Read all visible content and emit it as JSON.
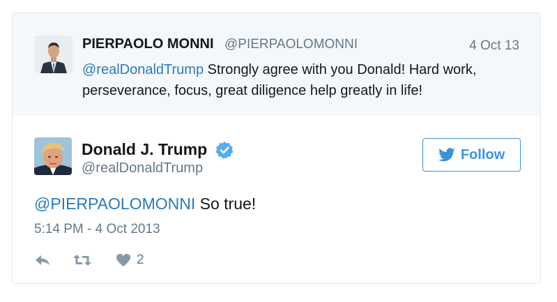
{
  "parent_tweet": {
    "name": "PIERPAOLO MONNI",
    "handle": "@PIERPAOLOMONNI",
    "date": "4 Oct 13",
    "mention": "@realDonaldTrump",
    "text": " Strongly agree with you Donald! Hard work, perseverance, focus, great diligence help greatly in life!"
  },
  "tweet": {
    "name": "Donald J. Trump",
    "handle": "@realDonaldTrump",
    "verified": true,
    "follow_label": "Follow",
    "mention": "@PIERPAOLOMONNI",
    "text": " So true!",
    "timestamp": "5:14 PM - 4 Oct 2013",
    "like_count": "2"
  },
  "icons": {
    "follow": "twitter-bird-icon",
    "verified": "verified-badge-icon",
    "reply": "reply-icon",
    "retweet": "retweet-icon",
    "like": "heart-icon"
  },
  "colors": {
    "link": "#2b7bb9",
    "follow": "#3b94d9",
    "muted": "#657786",
    "parent_background": "#f5f8fa"
  }
}
